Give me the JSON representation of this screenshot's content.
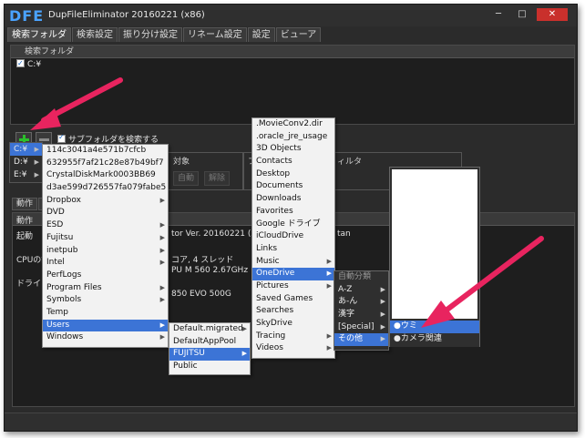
{
  "window": {
    "logo": "DFE",
    "title": "DupFileEliminator 20160221 (x86)",
    "controls": [
      "─",
      "□",
      "✕"
    ]
  },
  "tabs": [
    "検索フォルダ",
    "検索設定",
    "振り分け設定",
    "リネーム設定",
    "設定",
    "ビューア"
  ],
  "folder_panel": {
    "header": "検索フォルダ",
    "items": [
      "C:¥"
    ]
  },
  "subfolder_label": "サブフォルダを検索する",
  "drives": [
    "C:¥",
    "D:¥",
    "E:¥"
  ],
  "groups": {
    "target_label": "対象",
    "auto_label": "自動",
    "release_label": "解除",
    "filter_prefix": "フ",
    "filter_label": "ィルタ"
  },
  "subtabs": [
    "動作",
    "ロ"
  ],
  "log": {
    "header": "動作",
    "start_label": "起動",
    "version_fragment": "tor Ver. 20160221 (x8",
    "version_tail": "tan",
    "cpu_label": "CPUの認",
    "cpu_cores": "コア, 4 スレッド",
    "cpu_model": "PU M 560 2.67GHz",
    "drive_label": "ドライブの",
    "drive_model": "850 EVO 500G"
  },
  "menus": {
    "c_root": {
      "items": [
        {
          "label": "114c3041a4e571b7cfcb",
          "sub": false
        },
        {
          "label": "632955f7af21c28e87b49bf7",
          "sub": false
        },
        {
          "label": "CrystalDiskMark0003BB69",
          "sub": false
        },
        {
          "label": "d3ae599d726557fa079fabe5",
          "sub": false
        },
        {
          "label": "Dropbox",
          "sub": true
        },
        {
          "label": "DVD",
          "sub": false
        },
        {
          "label": "ESD",
          "sub": true
        },
        {
          "label": "Fujitsu",
          "sub": true
        },
        {
          "label": "inetpub",
          "sub": true
        },
        {
          "label": "Intel",
          "sub": true
        },
        {
          "label": "PerfLogs",
          "sub": false
        },
        {
          "label": "Program Files",
          "sub": true
        },
        {
          "label": "Symbols",
          "sub": true
        },
        {
          "label": "Temp",
          "sub": false
        },
        {
          "label": "Users",
          "sub": true,
          "hl": true
        },
        {
          "label": "Windows",
          "sub": true
        }
      ]
    },
    "users": {
      "items": [
        {
          "label": "Default.migrated",
          "sub": true
        },
        {
          "label": "DefaultAppPool",
          "sub": false
        },
        {
          "label": "FUJITSU",
          "sub": true,
          "hl": true
        },
        {
          "label": "Public",
          "sub": false
        }
      ]
    },
    "fujitsu": {
      "items": [
        {
          "label": ".MovieConv2.dir",
          "sub": false
        },
        {
          "label": ".oracle_jre_usage",
          "sub": false
        },
        {
          "label": "3D Objects",
          "sub": false
        },
        {
          "label": "Contacts",
          "sub": false
        },
        {
          "label": "Desktop",
          "sub": false
        },
        {
          "label": "Documents",
          "sub": false
        },
        {
          "label": "Downloads",
          "sub": false
        },
        {
          "label": "Favorites",
          "sub": false
        },
        {
          "label": "Google ドライブ",
          "sub": false
        },
        {
          "label": "iCloudDrive",
          "sub": false
        },
        {
          "label": "Links",
          "sub": false
        },
        {
          "label": "Music",
          "sub": true
        },
        {
          "label": "OneDrive",
          "sub": true,
          "hl": true
        },
        {
          "label": "Pictures",
          "sub": true
        },
        {
          "label": "Saved Games",
          "sub": false
        },
        {
          "label": "Searches",
          "sub": false
        },
        {
          "label": "SkyDrive",
          "sub": false
        },
        {
          "label": "Tracing",
          "sub": true
        },
        {
          "label": "Videos",
          "sub": true
        }
      ]
    },
    "onedrive": {
      "items": [
        {
          "label": "自動分類",
          "sub": false,
          "grey": true
        },
        {
          "label": "A-Z",
          "sub": true
        },
        {
          "label": "あ-ん",
          "sub": true
        },
        {
          "label": "漢字",
          "sub": true
        },
        {
          "label": "[Special]",
          "sub": true
        },
        {
          "label": "その他",
          "sub": true,
          "hl": true
        }
      ]
    },
    "other": {
      "items": [
        {
          "label": "●ウミ",
          "sub": false,
          "hl": true
        },
        {
          "label": "●カメラ関連",
          "sub": false
        }
      ]
    }
  },
  "colors": {
    "accent": "#3c74d6",
    "annotation": "#e8245f",
    "window_bg": "#2b2b2b",
    "plus_green": "#2bbf2b",
    "logo_blue": "#4aa3ff"
  },
  "icons": [
    "plus-icon",
    "minus-icon",
    "checkbox-icon",
    "submenu-arrow-icon",
    "annotation-arrow-icon"
  ]
}
